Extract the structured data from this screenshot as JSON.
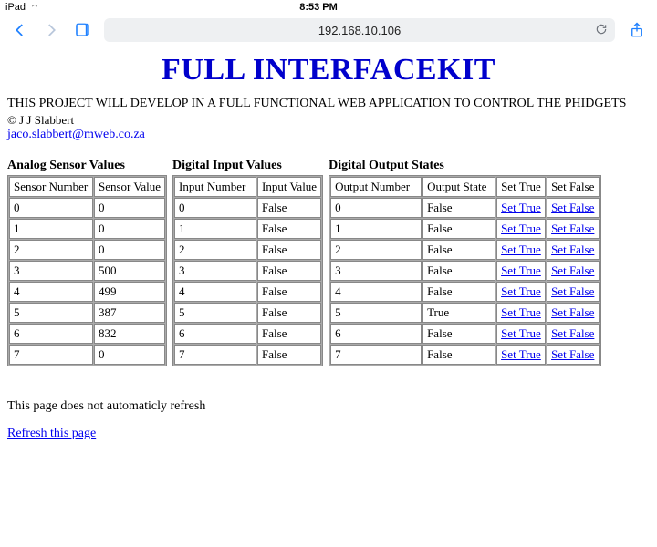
{
  "status": {
    "carrier": "iPad",
    "time": "8:53 PM"
  },
  "nav": {
    "url": "192.168.10.106"
  },
  "page": {
    "title": "FULL INTERFACEKIT",
    "description": "THIS PROJECT WILL DEVELOP IN A FULL FUNCTIONAL WEB APPLICATION TO CONTROL THE PHIDGETS",
    "copyright": "© J J Slabbert",
    "email": "jaco.slabbert@mweb.co.za",
    "footer_note": "This page does not automaticly refresh",
    "refresh_label": "Refresh this page"
  },
  "analog": {
    "title": "Analog Sensor Values",
    "col1": "Sensor Number",
    "col2": "Sensor Value",
    "rows": [
      {
        "n": "0",
        "v": "0"
      },
      {
        "n": "1",
        "v": "0"
      },
      {
        "n": "2",
        "v": "0"
      },
      {
        "n": "3",
        "v": "500"
      },
      {
        "n": "4",
        "v": "499"
      },
      {
        "n": "5",
        "v": "387"
      },
      {
        "n": "6",
        "v": "832"
      },
      {
        "n": "7",
        "v": "0"
      }
    ]
  },
  "digital_in": {
    "title": "Digital Input Values",
    "col1": "Input Number",
    "col2": "Input Value",
    "rows": [
      {
        "n": "0",
        "v": "False"
      },
      {
        "n": "1",
        "v": "False"
      },
      {
        "n": "2",
        "v": "False"
      },
      {
        "n": "3",
        "v": "False"
      },
      {
        "n": "4",
        "v": "False"
      },
      {
        "n": "5",
        "v": "False"
      },
      {
        "n": "6",
        "v": "False"
      },
      {
        "n": "7",
        "v": "False"
      }
    ]
  },
  "digital_out": {
    "title": "Digital Output States",
    "col1": "Output Number",
    "col2": "Output State",
    "col3": "Set True",
    "col4": "Set False",
    "set_true_label": "Set True",
    "set_false_label": "Set False",
    "rows": [
      {
        "n": "0",
        "v": "False"
      },
      {
        "n": "1",
        "v": "False"
      },
      {
        "n": "2",
        "v": "False"
      },
      {
        "n": "3",
        "v": "False"
      },
      {
        "n": "4",
        "v": "False"
      },
      {
        "n": "5",
        "v": "True"
      },
      {
        "n": "6",
        "v": "False"
      },
      {
        "n": "7",
        "v": "False"
      }
    ]
  }
}
